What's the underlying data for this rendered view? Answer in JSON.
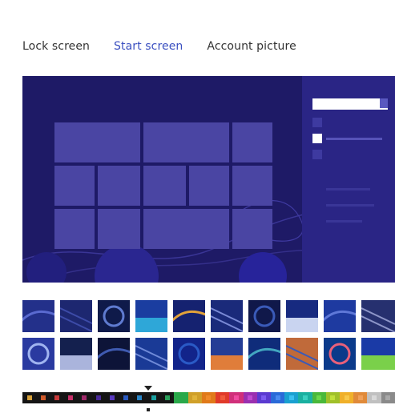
{
  "tabs": [
    {
      "label": "Lock screen",
      "selected": false
    },
    {
      "label": "Start screen",
      "selected": true
    },
    {
      "label": "Account picture",
      "selected": false
    }
  ],
  "colors": {
    "accent": "#3a4fc0",
    "background": "#1e1a66",
    "tile": "#4a45a3",
    "charm": "#2a2585"
  },
  "patterns": [
    {
      "bg": "#23308a",
      "accent": "#5a6ad0"
    },
    {
      "bg": "#1d2770",
      "accent": "#3d4ba8"
    },
    {
      "bg": "#0f1a4a",
      "accent": "#5f7bd0"
    },
    {
      "bg": "#1a3da0",
      "accent": "#2ea7d8"
    },
    {
      "bg": "#152270",
      "accent": "#e2a23a"
    },
    {
      "bg": "#1a2a7a",
      "accent": "#7a8ad6"
    },
    {
      "bg": "#10184a",
      "accent": "#3a5ab8"
    },
    {
      "bg": "#172a80",
      "accent": "#c9d4f0"
    },
    {
      "bg": "#1e3aa0",
      "accent": "#5f78d8"
    },
    {
      "bg": "#26306f",
      "accent": "#8d95c8"
    },
    {
      "bg": "#2a3aa0",
      "accent": "#a0b4f0"
    },
    {
      "bg": "#14204e",
      "accent": "#aab4dc"
    },
    {
      "bg": "#0d1438",
      "accent": "#3f5ab0"
    },
    {
      "bg": "#1a3a96",
      "accent": "#6f8ad8"
    },
    {
      "bg": "#12248a",
      "accent": "#2a5ac6"
    },
    {
      "bg": "#243d95",
      "accent": "#e07d3a"
    },
    {
      "bg": "#0f2c7a",
      "accent": "#43a7c0"
    },
    {
      "bg": "#c06a3a",
      "accent": "#3a5ab8"
    },
    {
      "bg": "#0b3a8a",
      "accent": "#e8607a"
    },
    {
      "bg": "#1a3aa6",
      "accent": "#7ad04a"
    }
  ],
  "palette": [
    {
      "bg": "#151515",
      "dot": "#d7a13a"
    },
    {
      "bg": "#151515",
      "dot": "#d05a2a"
    },
    {
      "bg": "#151515",
      "dot": "#c83a3a"
    },
    {
      "bg": "#151515",
      "dot": "#c8306a"
    },
    {
      "bg": "#151515",
      "dot": "#a02a6a"
    },
    {
      "bg": "#151515",
      "dot": "#4a2a9a"
    },
    {
      "bg": "#151515",
      "dot": "#5a3ac0"
    },
    {
      "bg": "#151515",
      "dot": "#2a5ac0"
    },
    {
      "bg": "#151515",
      "dot": "#2a86c8"
    },
    {
      "bg": "#151515",
      "dot": "#1aa0a0"
    },
    {
      "bg": "#151515",
      "dot": "#2aa05a"
    },
    {
      "bg": "#2aa84a",
      "dot": "#2aa84a"
    },
    {
      "bg": "#d0a02a",
      "dot": "#e0b43a"
    },
    {
      "bg": "#e07a1a",
      "dot": "#f08a2a"
    },
    {
      "bg": "#e03a2a",
      "dot": "#f05a3a"
    },
    {
      "bg": "#d0307a",
      "dot": "#f04aa0"
    },
    {
      "bg": "#9a30b0",
      "dot": "#c04ad0"
    },
    {
      "bg": "#5a3ad0",
      "dot": "#7a5af0"
    },
    {
      "bg": "#2a6ad8",
      "dot": "#4a8af0"
    },
    {
      "bg": "#1aa0d0",
      "dot": "#3ac0f0"
    },
    {
      "bg": "#1ab0a0",
      "dot": "#3ad0c0"
    },
    {
      "bg": "#4ab83a",
      "dot": "#6ad84a"
    },
    {
      "bg": "#a0c02a",
      "dot": "#c0e03a"
    },
    {
      "bg": "#f0b02a",
      "dot": "#f8c84a"
    },
    {
      "bg": "#e08a3a",
      "dot": "#f0a05a"
    },
    {
      "bg": "#c0c0c0",
      "dot": "#d8d8d8"
    },
    {
      "bg": "#8a8a8a",
      "dot": "#a8a8a8"
    }
  ]
}
